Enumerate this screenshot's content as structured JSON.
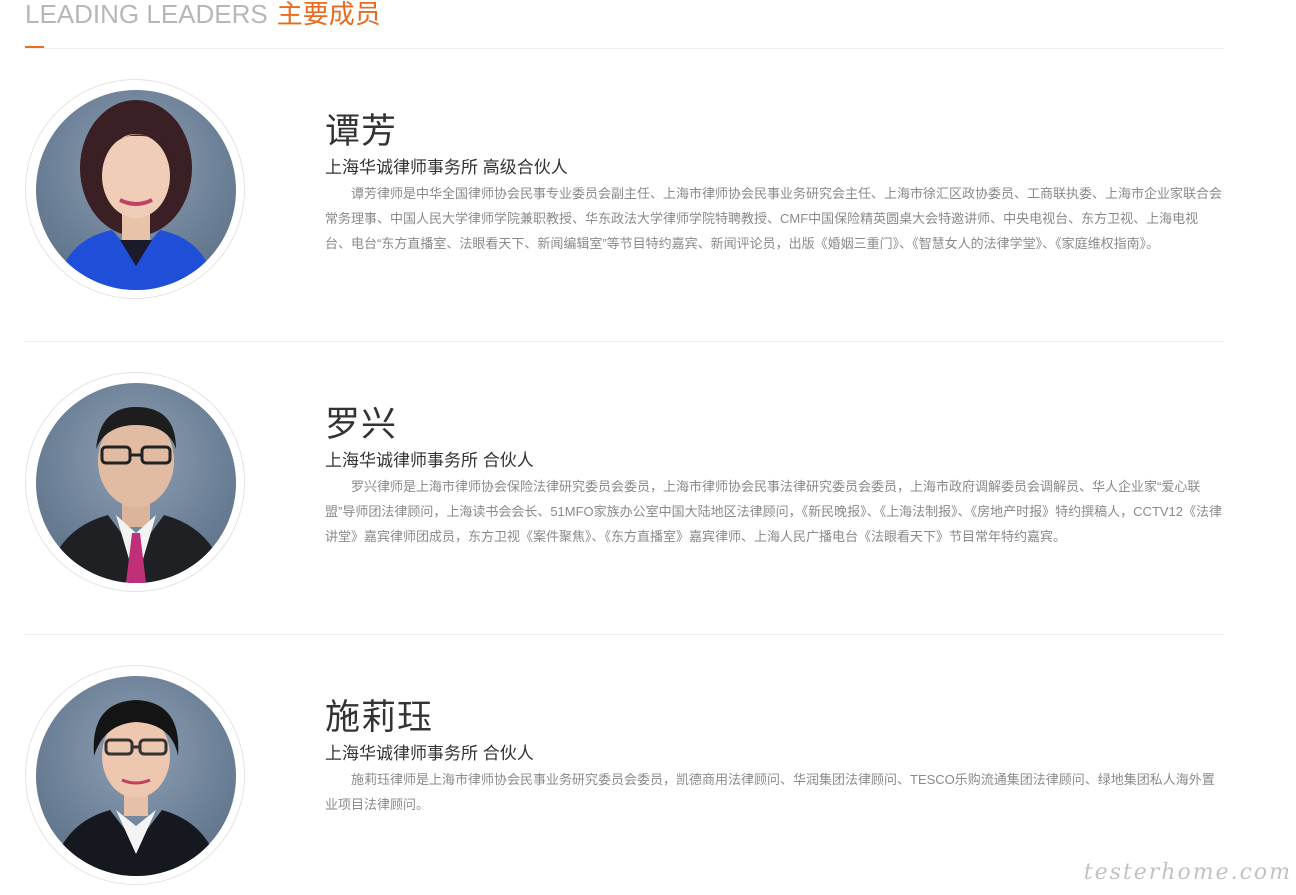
{
  "section": {
    "title_en": "LEADING LEADERS",
    "title_cn": "主要成员"
  },
  "members": [
    {
      "name": "谭芳",
      "role": "上海华诚律师事务所 高级合伙人",
      "bio": "谭芳律师是中华全国律师协会民事专业委员会副主任、上海市律师协会民事业务研究会主任、上海市徐汇区政协委员、工商联执委、上海市企业家联合会常务理事、中国人民大学律师学院兼职教授、华东政法大学律师学院特聘教授、CMF中国保险精英圆桌大会特邀讲师、中央电视台、东方卫视、上海电视台、电台“东方直播室、法眼看天下、新闻编辑室”等节目特约嘉宾、新闻评论员，出版《婚姻三重门》、《智慧女人的法律学堂》、《家庭维权指南》。"
    },
    {
      "name": "罗兴",
      "role": "上海华诚律师事务所 合伙人",
      "bio": "罗兴律师是上海市律师协会保险法律研究委员会委员，上海市律师协会民事法律研究委员会委员，上海市政府调解委员会调解员、华人企业家“爱心联盟”导师团法律顾问，上海读书会会长、51MFO家族办公室中国大陆地区法律顾问，《新民晚报》、《上海法制报》、《房地产时报》特约撰稿人，CCTV12《法律讲堂》嘉宾律师团成员，东方卫视《案件聚焦》、《东方直播室》嘉宾律师、上海人民广播电台《法眼看天下》节目常年特约嘉宾。"
    },
    {
      "name": "施莉珏",
      "role": "上海华诚律师事务所 合伙人",
      "bio": "施莉珏律师是上海市律师协会民事业务研究委员会委员，凯德商用法律顾问、华润集团法律顾问、TESCO乐购流通集团法律顾问、绿地集团私人海外置业项目法律顾问。"
    }
  ],
  "watermark": "testerhome.com",
  "colors": {
    "accent": "#ea6b1f",
    "title_gray": "#b7b7b7",
    "text_dark": "#333333",
    "text_muted": "#8a8a8a",
    "divider": "#eeeeee"
  }
}
